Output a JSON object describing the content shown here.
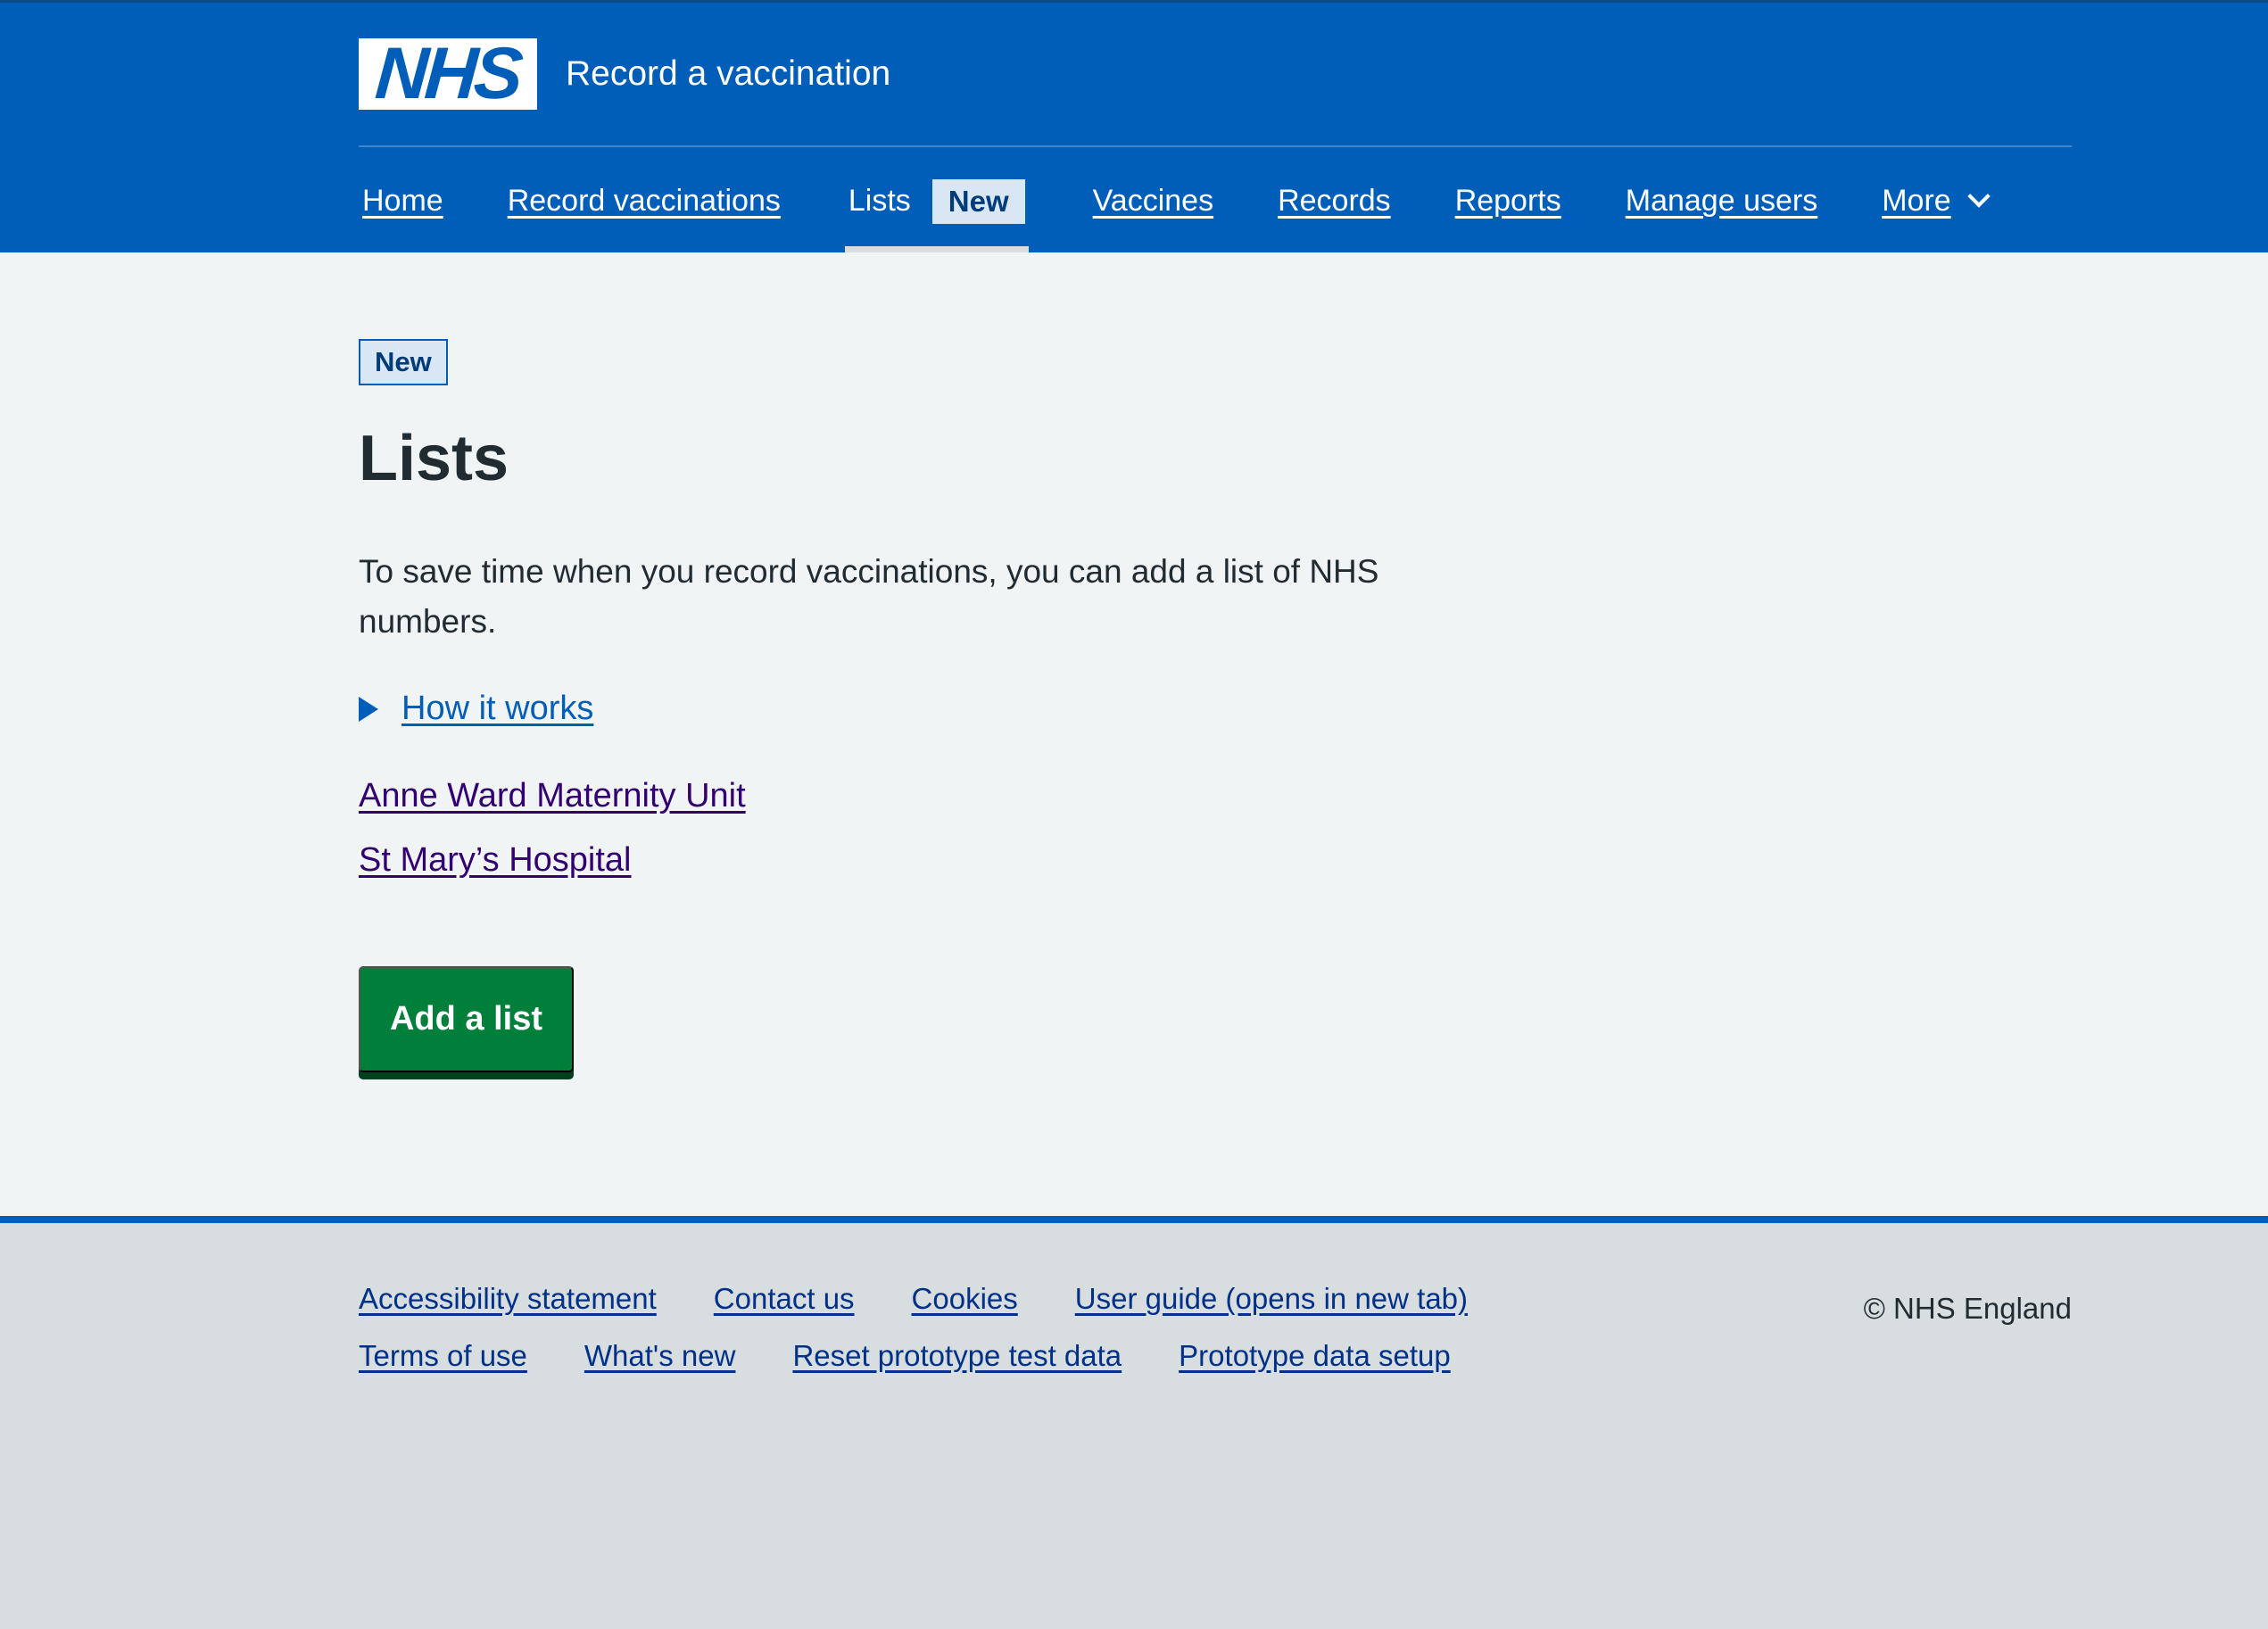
{
  "header": {
    "logo_text": "NHS",
    "service_name": "Record a vaccination"
  },
  "nav": {
    "items": [
      {
        "label": "Home"
      },
      {
        "label": "Record vaccinations"
      },
      {
        "label": "Lists",
        "tag": "New",
        "current": true
      },
      {
        "label": "Vaccines"
      },
      {
        "label": "Records"
      },
      {
        "label": "Reports"
      },
      {
        "label": "Manage users"
      },
      {
        "label": "More"
      }
    ]
  },
  "main": {
    "tag": "New",
    "title": "Lists",
    "lead": "To save time when you record vaccinations, you can add a list of NHS numbers.",
    "details_summary": "How it works",
    "lists": [
      {
        "name": "Anne Ward Maternity Unit"
      },
      {
        "name": "St Mary’s Hospital"
      }
    ],
    "add_button": "Add a list"
  },
  "footer": {
    "links_row1": [
      "Accessibility statement",
      "Contact us",
      "Cookies",
      "User guide (opens in new tab)"
    ],
    "links_row2": [
      "Terms of use",
      "What's new",
      "Reset prototype test data",
      "Prototype data setup"
    ],
    "copyright": "© NHS England"
  },
  "colors": {
    "nhs_blue": "#005eb8",
    "button_green": "#007f3b",
    "visited_link": "#330072",
    "page_background": "#f0f4f5",
    "footer_background": "#d8dde0"
  }
}
